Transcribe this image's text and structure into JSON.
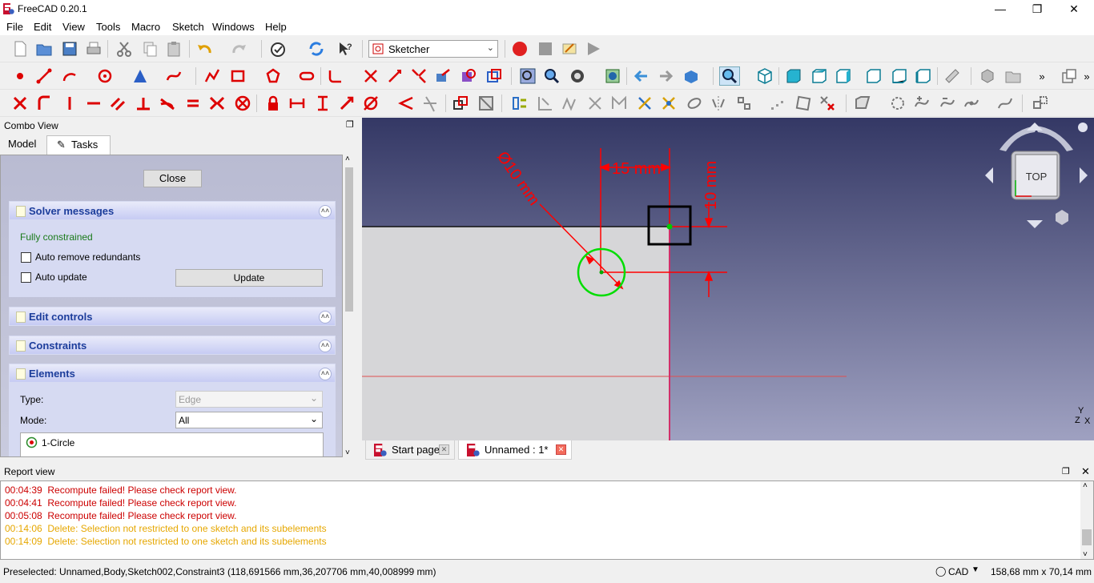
{
  "window": {
    "title": "FreeCAD 0.20.1"
  },
  "menu": [
    "File",
    "Edit",
    "View",
    "Tools",
    "Macro",
    "Sketch",
    "Windows",
    "Help"
  ],
  "workbench": {
    "selected": "Sketcher"
  },
  "combo_view": {
    "title": "Combo View",
    "tabs": [
      "Model",
      "Tasks"
    ],
    "close_label": "Close",
    "solver": {
      "title": "Solver messages",
      "status": "Fully constrained",
      "auto_remove_label": "Auto remove redundants",
      "auto_update_label": "Auto update",
      "update_label": "Update"
    },
    "edit_controls": {
      "title": "Edit controls"
    },
    "constraints": {
      "title": "Constraints"
    },
    "elements": {
      "title": "Elements",
      "type_label": "Type:",
      "type_value": "Edge",
      "mode_label": "Mode:",
      "mode_value": "All",
      "items": [
        "1-Circle"
      ]
    }
  },
  "viewport": {
    "dims": {
      "horizontal": "15 mm",
      "vertical": "10 mm",
      "diameter": "Ø10 mm"
    },
    "navcube_face": "TOP",
    "axis_labels": {
      "y": "Y",
      "z": "Z",
      "x": "X"
    },
    "colors": {
      "constraint": "#ff0000",
      "circle": "#00dd00",
      "selection": "#000000"
    }
  },
  "doc_tabs": [
    "Start page",
    "Unnamed : 1*"
  ],
  "report_view": {
    "title": "Report view",
    "lines": [
      {
        "time": "00:04:39",
        "msg": "Recompute failed! Please check report view.",
        "level": "error"
      },
      {
        "time": "00:04:41",
        "msg": "Recompute failed! Please check report view.",
        "level": "error"
      },
      {
        "time": "00:05:08",
        "msg": "Recompute failed! Please check report view.",
        "level": "error"
      },
      {
        "time": "00:14:06",
        "msg": "Delete: Selection not restricted to one sketch and its subelements",
        "level": "warning"
      },
      {
        "time": "00:14:09",
        "msg": "Delete: Selection not restricted to one sketch and its subelements",
        "level": "warning"
      }
    ],
    "colors": {
      "error": "#cc0000",
      "warning": "#e6a700"
    }
  },
  "status": {
    "preselected": "Preselected: Unnamed,Body,Sketch002,Constraint3 (118,691566 mm,36,207706 mm,40,008999 mm)",
    "nav_style": "CAD",
    "dimensions": "158,68 mm x 70,14 mm"
  }
}
